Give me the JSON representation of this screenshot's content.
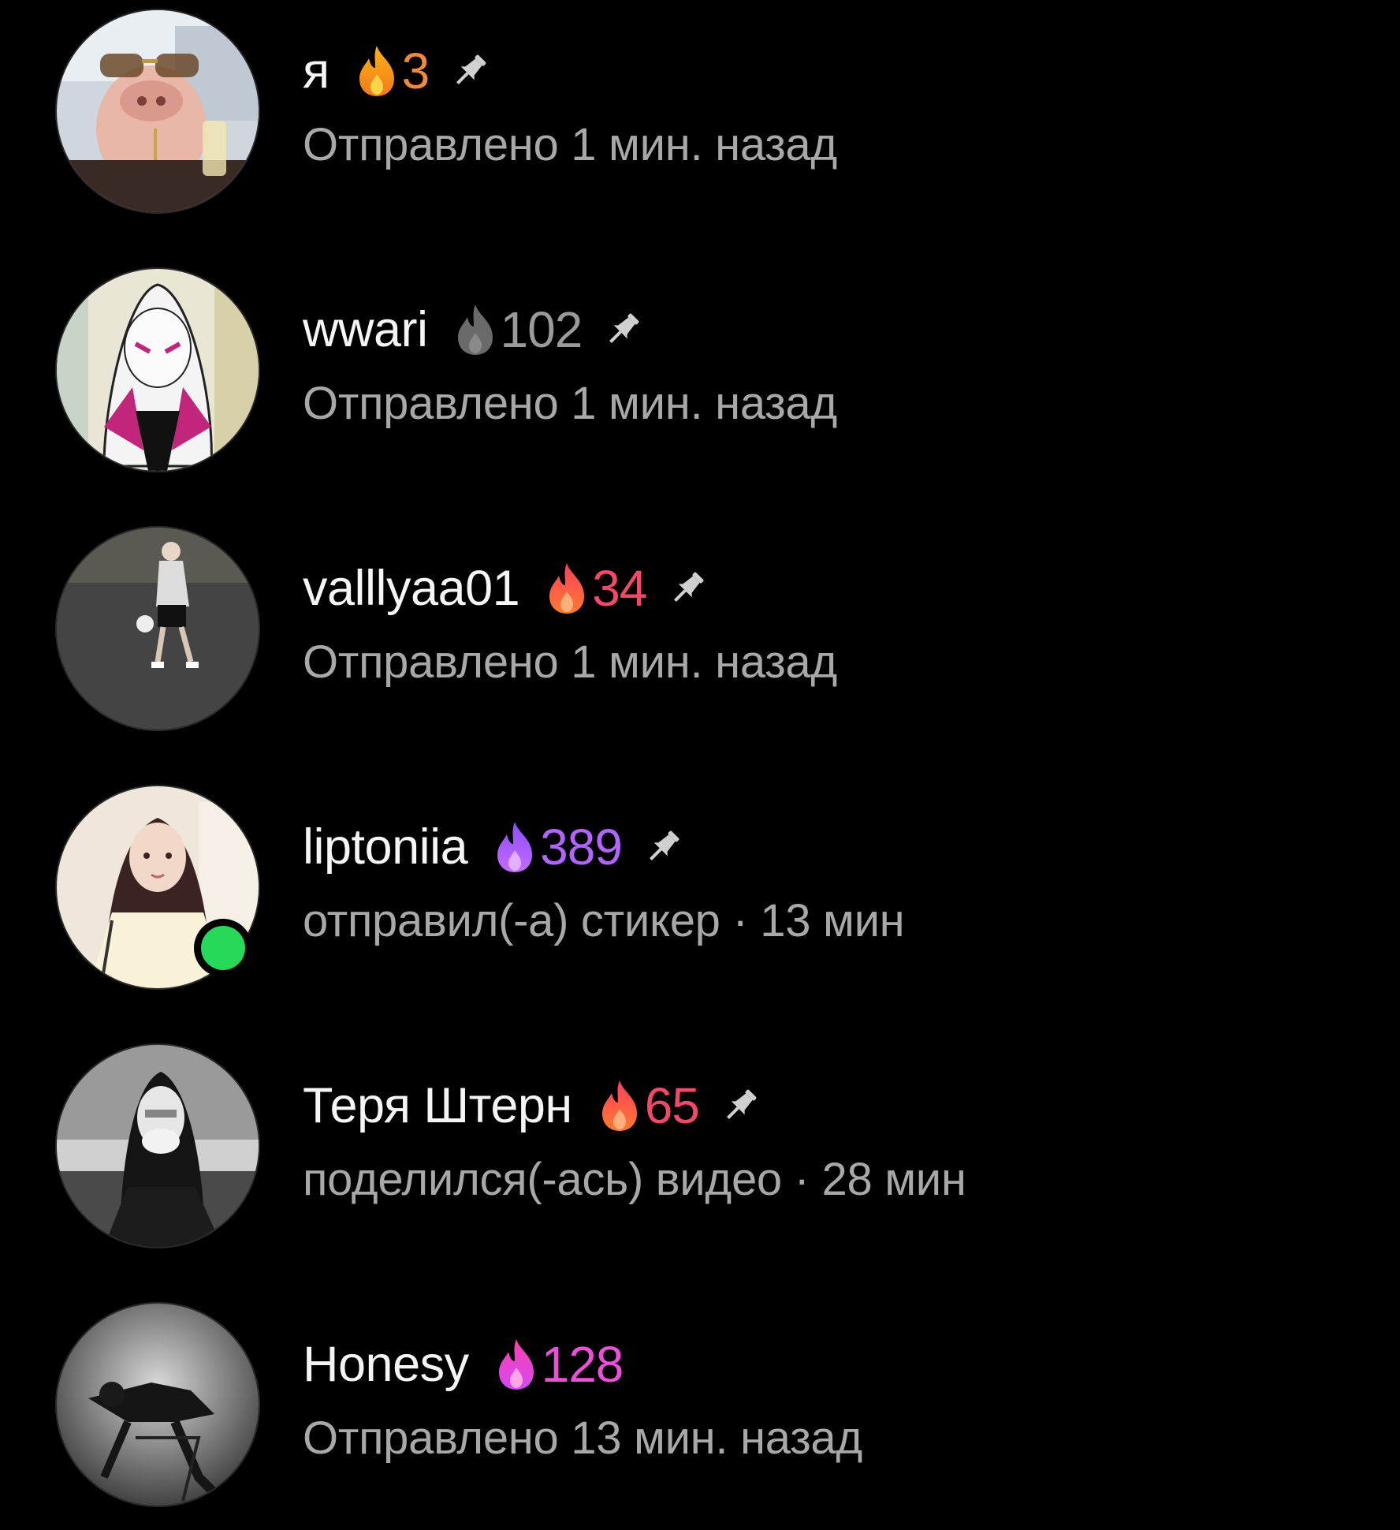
{
  "colors": {
    "background": "#000000",
    "name": "#f5f5f5",
    "subtitle": "#a8a8a8",
    "online": "#27d959"
  },
  "chats": [
    {
      "name": "я",
      "streak": "3",
      "streak_color": "#f08a3a",
      "fire_icon": "fire-orange-icon",
      "pinned": true,
      "subtitle": "Отправлено 1 мин. назад"
    },
    {
      "name": "wwari",
      "streak": "102",
      "streak_color": "#9a9a9a",
      "fire_icon": "fire-gray-icon",
      "pinned": true,
      "subtitle": "Отправлено 1 мин. назад"
    },
    {
      "name": "valllyaa01",
      "streak": "34",
      "streak_color": "#f2496a",
      "fire_icon": "fire-red-icon",
      "pinned": true,
      "subtitle": "Отправлено 1 мин. назад"
    },
    {
      "name": "liptoniia",
      "streak": "389",
      "streak_color": "#b065ff",
      "fire_icon": "fire-purple-icon",
      "pinned": true,
      "online": true,
      "subtitle": "отправил(-а) стикер · 13 мин"
    },
    {
      "name": "Теря Штерн",
      "streak": "65",
      "streak_color": "#f2496a",
      "fire_icon": "fire-red-icon",
      "pinned": true,
      "subtitle": "поделился(-ась) видео · 28 мин"
    },
    {
      "name": "Honesy",
      "streak": "128",
      "streak_color": "#ec4fd8",
      "fire_icon": "fire-magenta-icon",
      "pinned": false,
      "subtitle": "Отправлено 13 мин. назад"
    }
  ]
}
